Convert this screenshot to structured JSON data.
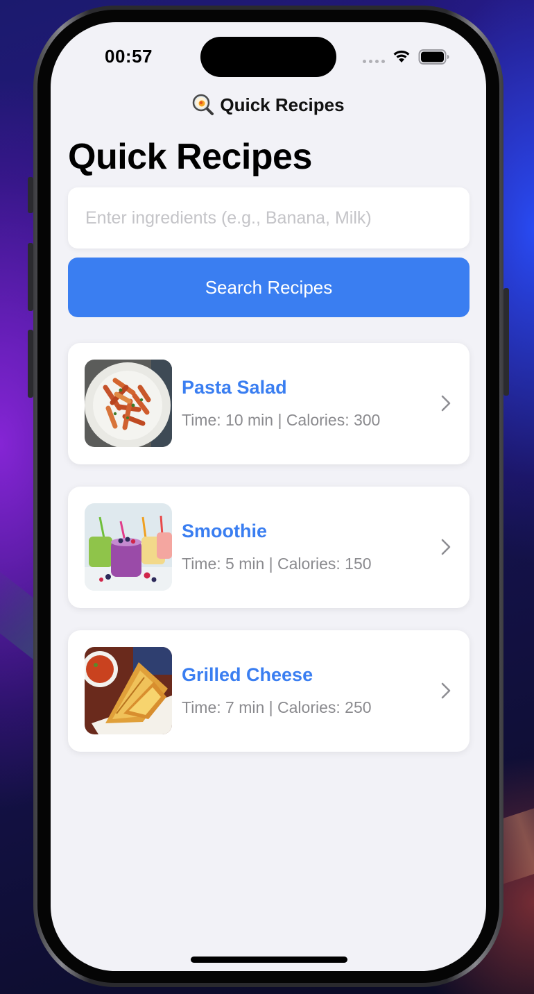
{
  "status_bar": {
    "time": "00:57"
  },
  "nav": {
    "title": "Quick Recipes",
    "emoji_icon": "magnifying-glass-icon"
  },
  "page": {
    "title": "Quick Recipes"
  },
  "search": {
    "placeholder": "Enter ingredients (e.g., Banana, Milk)",
    "value": "",
    "button_label": "Search Recipes"
  },
  "recipes": [
    {
      "name": "Pasta Salad",
      "meta": "Time: 10 min | Calories: 300",
      "image": "pasta-salad-photo"
    },
    {
      "name": "Smoothie",
      "meta": "Time: 5 min | Calories: 150",
      "image": "smoothie-photo"
    },
    {
      "name": "Grilled Cheese",
      "meta": "Time: 7 min | Calories: 250",
      "image": "grilled-cheese-photo"
    }
  ],
  "colors": {
    "accent": "#3a7ef1",
    "background": "#f2f2f7",
    "card": "#ffffff",
    "secondary_text": "#8a8a8e"
  }
}
